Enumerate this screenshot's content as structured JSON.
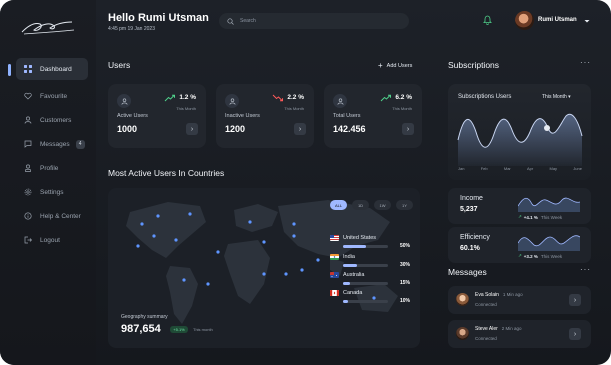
{
  "header": {
    "greeting": "Hello Rumi Utsman",
    "datetime": "4:45 pm 19 Jan 2023",
    "search_placeholder": "Search",
    "user_name": "Rumi Utsman"
  },
  "sidebar": {
    "items": [
      {
        "label": "Dashboard",
        "icon": "grid-icon",
        "active": true
      },
      {
        "label": "Favourite",
        "icon": "heart-icon"
      },
      {
        "label": "Customers",
        "icon": "user-icon"
      },
      {
        "label": "Messages",
        "icon": "chat-icon",
        "badge": "4"
      },
      {
        "label": "Profile",
        "icon": "profile-icon"
      },
      {
        "label": "Settings",
        "icon": "gear-icon"
      },
      {
        "label": "Help & Center",
        "icon": "info-icon"
      },
      {
        "label": "Logout",
        "icon": "logout-icon"
      }
    ]
  },
  "users": {
    "title": "Users",
    "add_label": "Add Users",
    "cards": [
      {
        "label": "Active Users",
        "value": "1000",
        "pct": "1.2 %",
        "period": "This Month",
        "trend": "up"
      },
      {
        "label": "Inactive Users",
        "value": "1200",
        "pct": "2.2 %",
        "period": "This Month",
        "trend": "down"
      },
      {
        "label": "Total Users",
        "value": "142.456",
        "pct": "6.2 %",
        "period": "This Month",
        "trend": "up"
      }
    ]
  },
  "countries": {
    "title": "Most Active Users In Countries",
    "filters": [
      "ALL",
      "1D",
      "1W",
      "1Y"
    ],
    "active_filter": "ALL",
    "geo_label": "Geography summary",
    "geo_total": "987,654",
    "geo_change": "+5.1%",
    "geo_note": "This month",
    "list": [
      {
        "name": "United States",
        "pct": "50%",
        "fraction": 0.5
      },
      {
        "name": "India",
        "pct": "30%",
        "fraction": 0.3
      },
      {
        "name": "Australia",
        "pct": "15%",
        "fraction": 0.15
      },
      {
        "name": "Canada",
        "pct": "10%",
        "fraction": 0.1
      }
    ]
  },
  "subscriptions": {
    "title": "Subscriptions",
    "chart_title": "Subscriptions Users",
    "period": "This Month",
    "months": [
      "Jan",
      "Feb",
      "Mar",
      "Apr",
      "May",
      "June"
    ]
  },
  "metrics": [
    {
      "label": "Income",
      "value": "5,237",
      "change": "+4.1 %",
      "note": "This Week"
    },
    {
      "label": "Efficiency",
      "value": "60.1%",
      "change": "+3.2 %",
      "note": "This Week"
    }
  ],
  "messages": {
    "title": "Messages",
    "items": [
      {
        "name": "Eva Solain",
        "time": "1 Min ago",
        "status": "Connected"
      },
      {
        "name": "Steve Aler",
        "time": "2 Min ago",
        "status": "Connected"
      }
    ]
  },
  "colors": {
    "accent": "#9fb8ff",
    "positive": "#4fd18b",
    "negative": "#ff5a5a",
    "background": "#191c22"
  }
}
